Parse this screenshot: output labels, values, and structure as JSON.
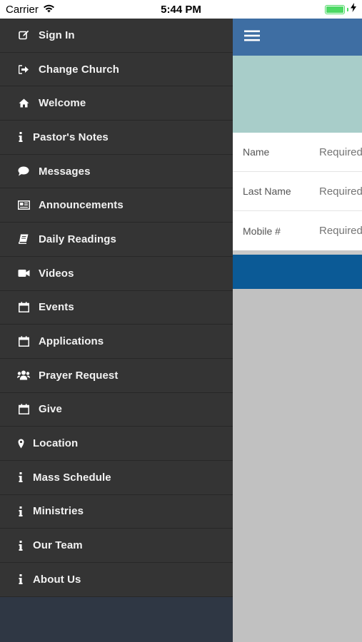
{
  "status": {
    "carrier": "Carrier",
    "time": "5:44 PM",
    "battery_percent": 100
  },
  "menu": {
    "items": [
      {
        "label": "Sign In",
        "icon": "edit-icon"
      },
      {
        "label": "Change Church",
        "icon": "sign-out-icon"
      },
      {
        "label": "Welcome",
        "icon": "home-icon"
      },
      {
        "label": "Pastor's Notes",
        "icon": "info-icon"
      },
      {
        "label": "Messages",
        "icon": "comment-icon"
      },
      {
        "label": "Announcements",
        "icon": "newspaper-icon"
      },
      {
        "label": "Daily Readings",
        "icon": "book-icon"
      },
      {
        "label": "Videos",
        "icon": "video-camera-icon"
      },
      {
        "label": "Events",
        "icon": "calendar-icon"
      },
      {
        "label": "Applications",
        "icon": "calendar-icon"
      },
      {
        "label": "Prayer Request",
        "icon": "users-icon"
      },
      {
        "label": "Give",
        "icon": "calendar-icon"
      },
      {
        "label": "Location",
        "icon": "map-marker-icon"
      },
      {
        "label": "Mass Schedule",
        "icon": "info-icon"
      },
      {
        "label": "Ministries",
        "icon": "info-icon"
      },
      {
        "label": "Our Team",
        "icon": "info-icon"
      },
      {
        "label": "About Us",
        "icon": "info-icon"
      }
    ]
  },
  "form": {
    "fields": [
      {
        "label": "Name",
        "placeholder": "Required"
      },
      {
        "label": "Last Name",
        "placeholder": "Required"
      },
      {
        "label": "Mobile #",
        "placeholder": "Required"
      }
    ]
  },
  "colors": {
    "drawer_bg": "#343434",
    "drawer_footer": "#2f3744",
    "top_bar": "#3e6ea3",
    "hero": "#a8cdc9",
    "submit_bar": "#0b5a96",
    "battery": "#4cd964"
  }
}
